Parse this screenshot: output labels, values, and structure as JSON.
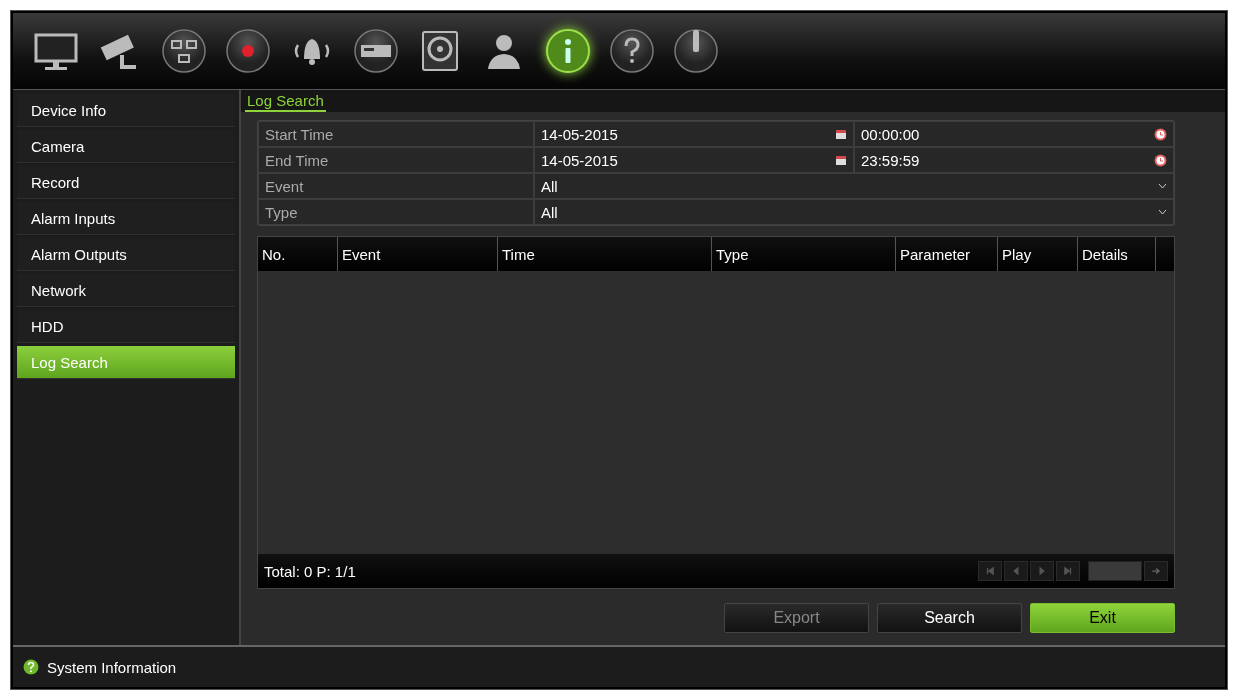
{
  "toolbar": [
    {
      "kind": "monitor",
      "selected": false
    },
    {
      "kind": "camera",
      "selected": false
    },
    {
      "kind": "network",
      "selected": false
    },
    {
      "kind": "record",
      "selected": false
    },
    {
      "kind": "alarm",
      "selected": false
    },
    {
      "kind": "device",
      "selected": false
    },
    {
      "kind": "hdd",
      "selected": false
    },
    {
      "kind": "user",
      "selected": false
    },
    {
      "kind": "info",
      "selected": true
    },
    {
      "kind": "help",
      "selected": false
    },
    {
      "kind": "power",
      "selected": false
    }
  ],
  "sidebar": {
    "items": [
      {
        "label": "Device Info",
        "selected": false
      },
      {
        "label": "Camera",
        "selected": false
      },
      {
        "label": "Record",
        "selected": false
      },
      {
        "label": "Alarm Inputs",
        "selected": false
      },
      {
        "label": "Alarm Outputs",
        "selected": false
      },
      {
        "label": "Network",
        "selected": false
      },
      {
        "label": "HDD",
        "selected": false
      },
      {
        "label": "Log Search",
        "selected": true
      }
    ]
  },
  "page_title": "Log Search",
  "form": [
    {
      "kind": "datetime",
      "label": "Start Time",
      "date": "14-05-2015",
      "time": "00:00:00"
    },
    {
      "kind": "datetime",
      "label": "End Time",
      "date": "14-05-2015",
      "time": "23:59:59"
    },
    {
      "kind": "select",
      "label": "Event",
      "value": "All"
    },
    {
      "kind": "select",
      "label": "Type",
      "value": "All"
    }
  ],
  "table": {
    "columns": [
      "No.",
      "Event",
      "Time",
      "Type",
      "Parameter",
      "Play",
      "Details"
    ]
  },
  "pager": {
    "summary": "Total: 0  P: 1/1"
  },
  "buttons": [
    {
      "label": "Export",
      "disabled": true,
      "primary": false
    },
    {
      "label": "Search",
      "disabled": false,
      "primary": false
    },
    {
      "label": "Exit",
      "disabled": false,
      "primary": true
    }
  ],
  "status_bar": {
    "text": "System Information"
  }
}
